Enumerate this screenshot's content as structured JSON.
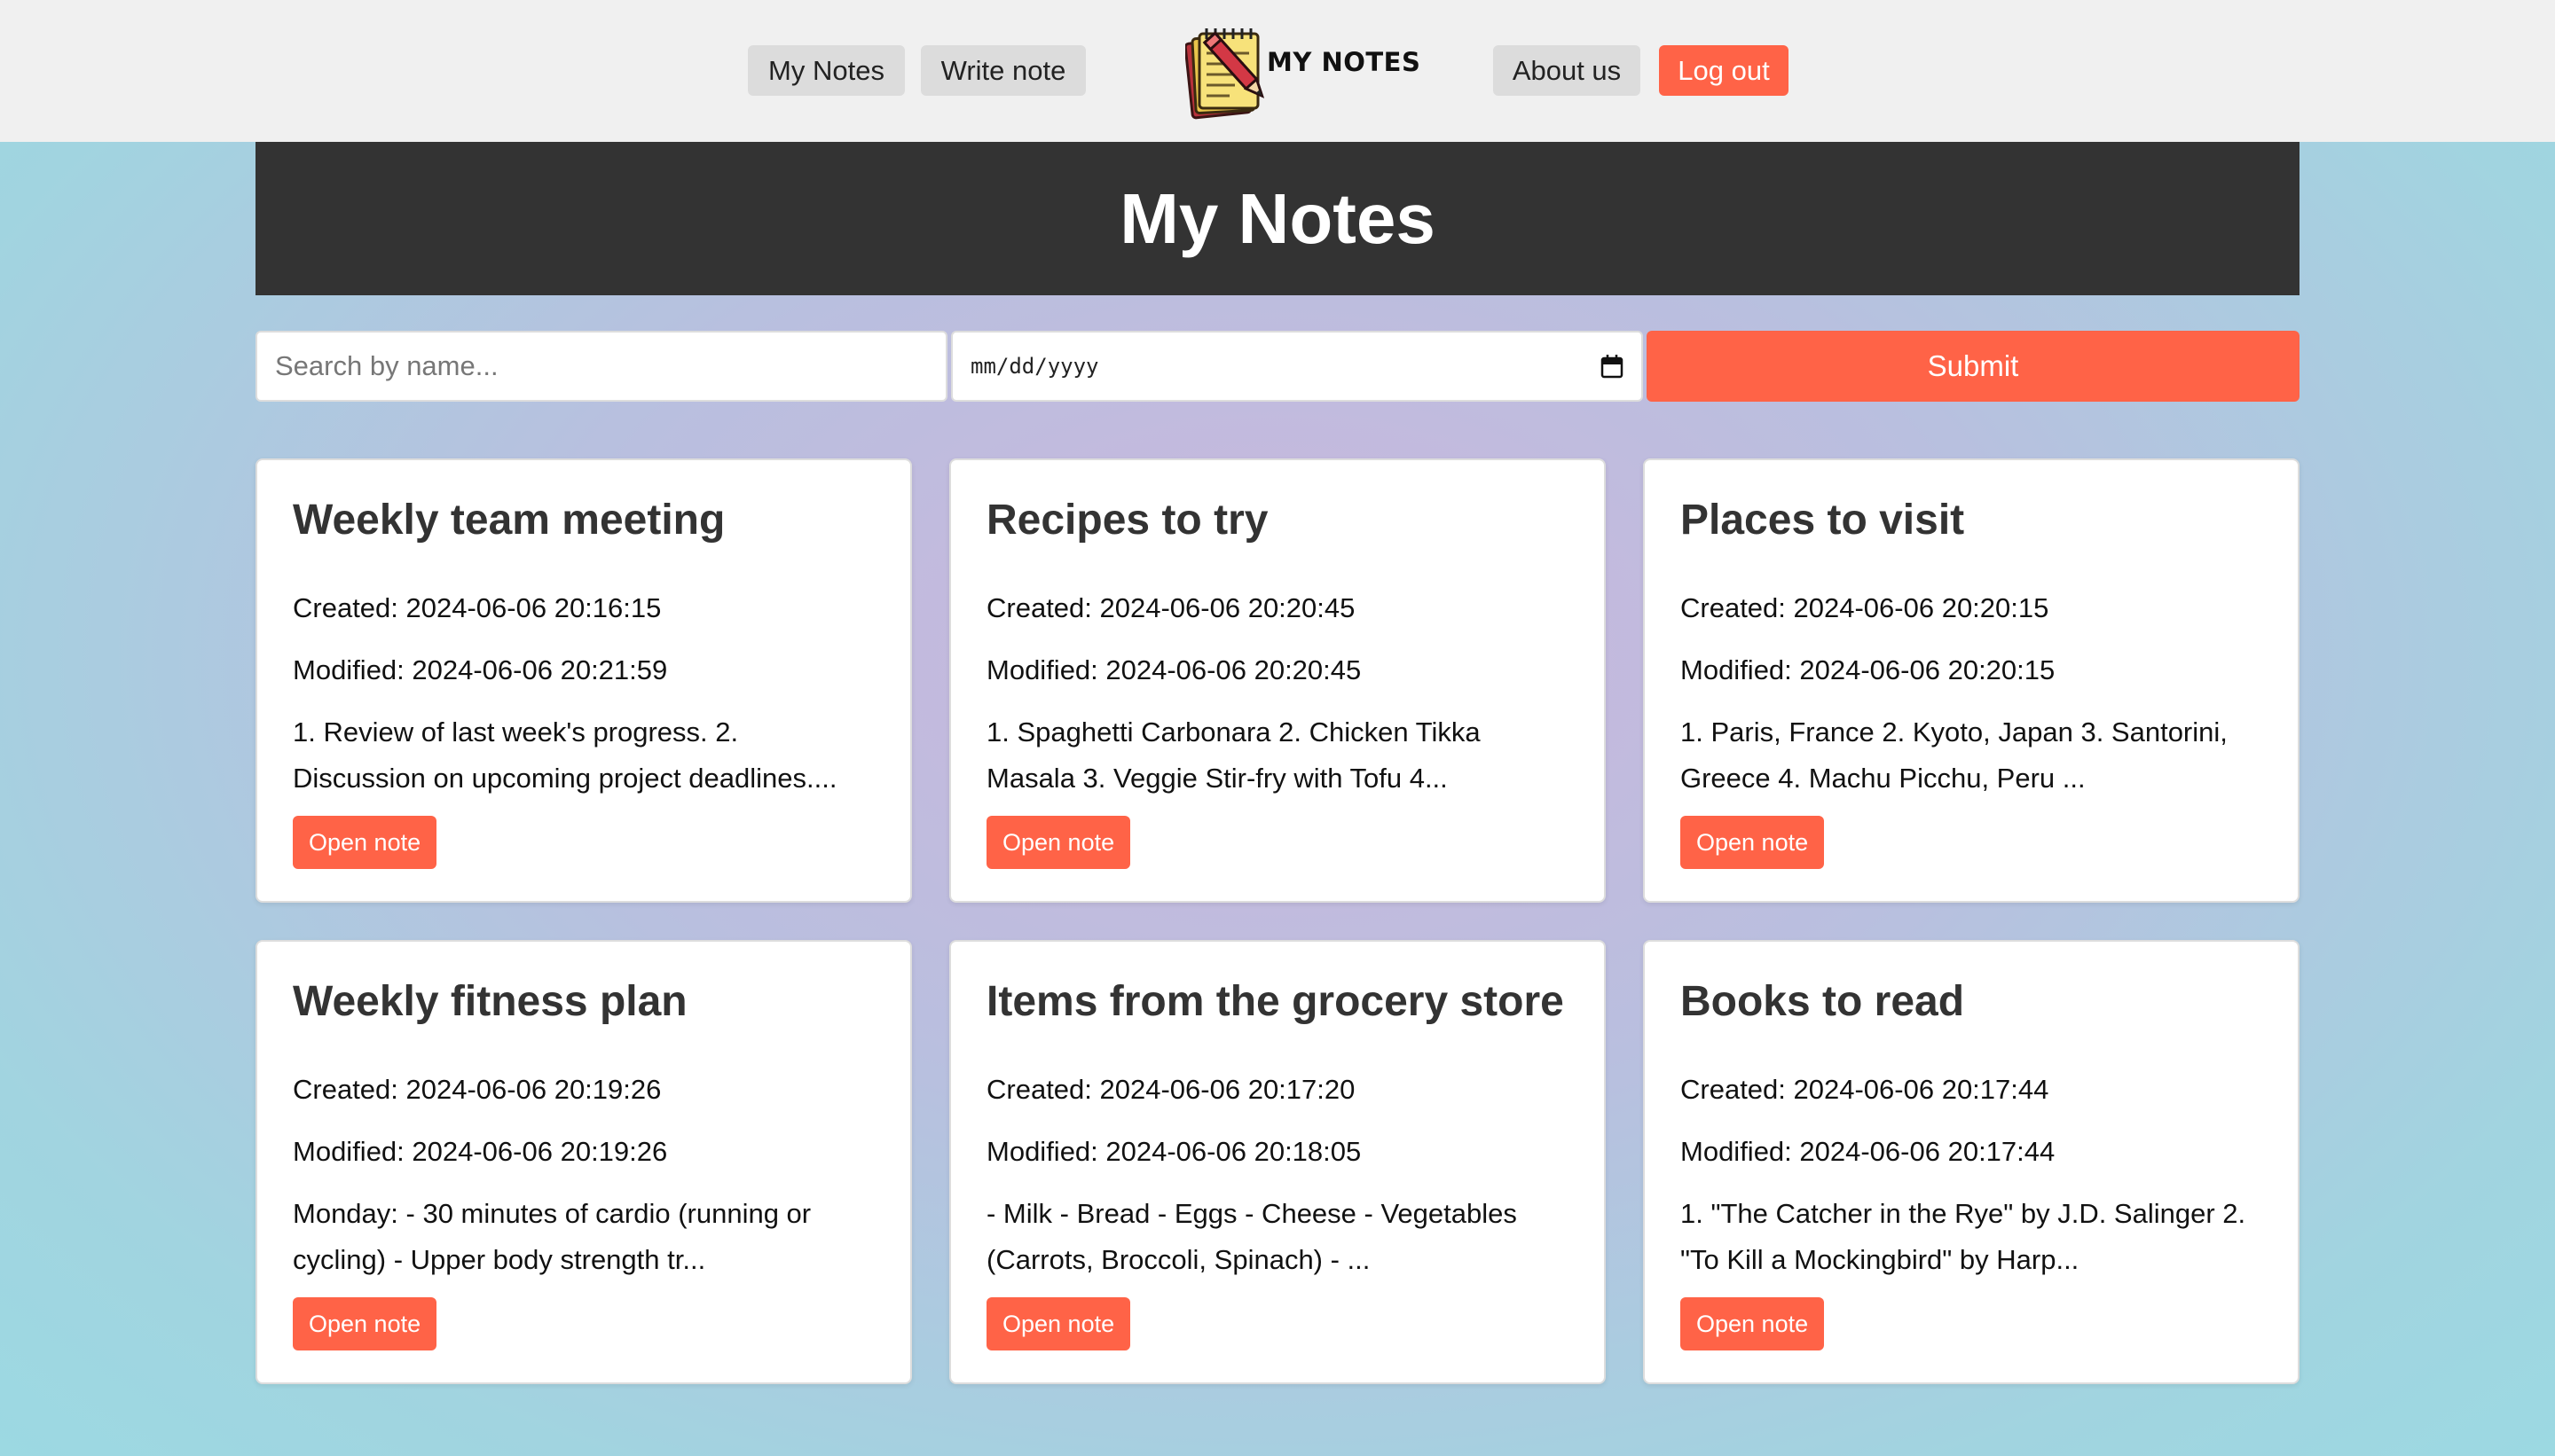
{
  "nav": {
    "my_notes": "My Notes",
    "write_note": "Write note",
    "logo_text": "MY NOTES",
    "about_us": "About us",
    "log_out": "Log out"
  },
  "banner": {
    "title": "My Notes"
  },
  "search": {
    "name_placeholder": "Search by name...",
    "date_placeholder": "mm/dd/yyyy",
    "submit_label": "Submit"
  },
  "colors": {
    "accent": "#ff6347",
    "banner_bg": "#333333",
    "navbar_bg": "#f0f0f0"
  },
  "notes": [
    {
      "title": "Weekly team meeting",
      "created": "Created: 2024-06-06 20:16:15",
      "modified": "Modified: 2024-06-06 20:21:59",
      "preview": "1. Review of last week's progress. 2. Discussion on upcoming project deadlines....",
      "button": "Open note"
    },
    {
      "title": "Recipes to try",
      "created": "Created: 2024-06-06 20:20:45",
      "modified": "Modified: 2024-06-06 20:20:45",
      "preview": "1. Spaghetti Carbonara 2. Chicken Tikka Masala 3. Veggie Stir-fry with Tofu 4...",
      "button": "Open note"
    },
    {
      "title": "Places to visit",
      "created": "Created: 2024-06-06 20:20:15",
      "modified": "Modified: 2024-06-06 20:20:15",
      "preview": "1. Paris, France 2. Kyoto, Japan 3. Santorini, Greece 4. Machu Picchu, Peru ...",
      "button": "Open note"
    },
    {
      "title": "Weekly fitness plan",
      "created": "Created: 2024-06-06 20:19:26",
      "modified": "Modified: 2024-06-06 20:19:26",
      "preview": "Monday: - 30 minutes of cardio (running or cycling) - Upper body strength tr...",
      "button": "Open note"
    },
    {
      "title": "Items from the grocery store",
      "created": "Created: 2024-06-06 20:17:20",
      "modified": "Modified: 2024-06-06 20:18:05",
      "preview": "- Milk - Bread - Eggs - Cheese - Vegetables (Carrots, Broccoli, Spinach) - ...",
      "button": "Open note"
    },
    {
      "title": "Books to read",
      "created": "Created: 2024-06-06 20:17:44",
      "modified": "Modified: 2024-06-06 20:17:44",
      "preview": "1. \"The Catcher in the Rye\" by J.D. Salinger 2. \"To Kill a Mockingbird\" by Harp...",
      "button": "Open note"
    }
  ]
}
